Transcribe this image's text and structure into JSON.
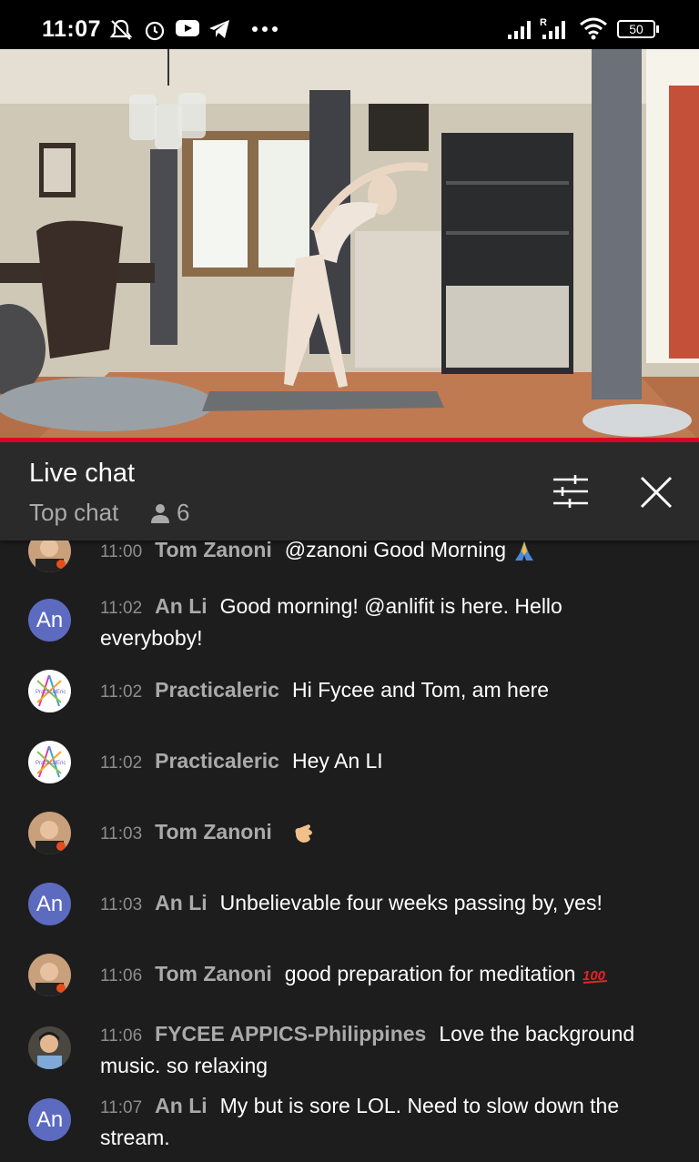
{
  "status_bar": {
    "time": "11:07",
    "battery": "50",
    "icons": [
      "mute-bell-icon",
      "alarm-icon",
      "youtube-icon",
      "telegram-icon",
      "more-dots-icon",
      "signal-icon",
      "roaming-signal-icon",
      "wifi-icon",
      "battery-icon"
    ]
  },
  "video": {
    "progress_fraction": 1.0,
    "accent": "#e1002d"
  },
  "chat_header": {
    "title": "Live chat",
    "mode": "Top chat",
    "viewer_count": "6",
    "icons": [
      "person-icon",
      "filter-sliders-icon",
      "close-icon"
    ]
  },
  "messages": [
    {
      "time": "11:00",
      "author": "Tom Zanoni",
      "text": "@zanoni Good Morning",
      "emoji": "folded-hands-icon",
      "avatar": "tom"
    },
    {
      "time": "11:02",
      "author": "An Li",
      "text": "Good morning! @anlifit is here. Hello everyboby!",
      "avatar": "an",
      "avatar_text": "An"
    },
    {
      "time": "11:02",
      "author": "Practicaleric",
      "text": "Hi Fycee and Tom, am here",
      "avatar": "practicaleric"
    },
    {
      "time": "11:02",
      "author": "Practicaleric",
      "text": "Hey An LI",
      "avatar": "practicaleric"
    },
    {
      "time": "11:03",
      "author": "Tom Zanoni",
      "text": "",
      "emoji": "hand-icon",
      "avatar": "tom"
    },
    {
      "time": "11:03",
      "author": "An Li",
      "text": "Unbelievable four weeks passing by, yes!",
      "avatar": "an",
      "avatar_text": "An"
    },
    {
      "time": "11:06",
      "author": "Tom Zanoni",
      "text": "good preparation for meditation",
      "emoji": "hundred-points-icon",
      "avatar": "tom"
    },
    {
      "time": "11:06",
      "author": "FYCEE APPICS-Philippines",
      "text": "Love the background music. so relaxing",
      "avatar": "fycee"
    },
    {
      "time": "11:07",
      "author": "An Li",
      "text": "My but is sore LOL. Need to slow down the stream.",
      "avatar": "an",
      "avatar_text": "An"
    }
  ],
  "colors": {
    "background": "#1d1d1d",
    "header": "#2a2a2a",
    "avatar_an": "#5c6bc0",
    "author": "#aaaaaa"
  }
}
